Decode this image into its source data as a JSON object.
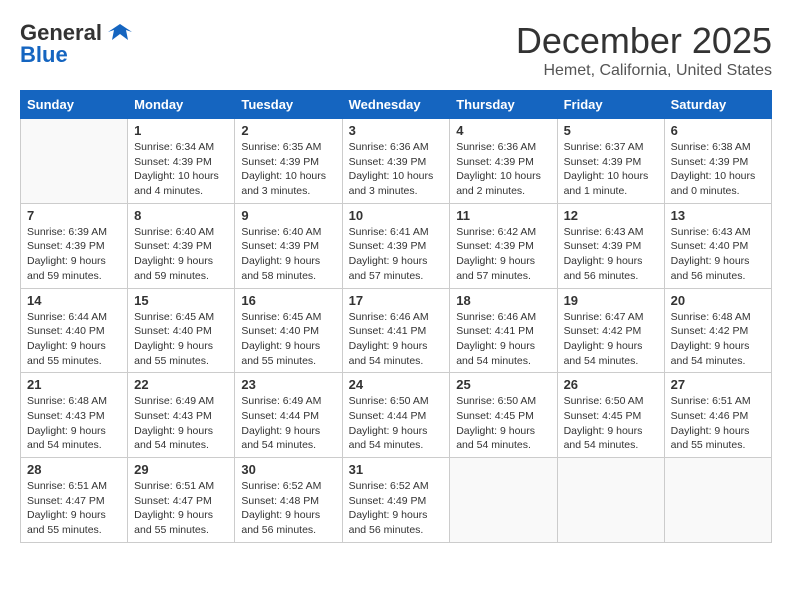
{
  "header": {
    "logo_line1": "General",
    "logo_line2": "Blue",
    "title": "December 2025",
    "subtitle": "Hemet, California, United States"
  },
  "days_of_week": [
    "Sunday",
    "Monday",
    "Tuesday",
    "Wednesday",
    "Thursday",
    "Friday",
    "Saturday"
  ],
  "weeks": [
    [
      {
        "day": "",
        "info": ""
      },
      {
        "day": "1",
        "info": "Sunrise: 6:34 AM\nSunset: 4:39 PM\nDaylight: 10 hours\nand 4 minutes."
      },
      {
        "day": "2",
        "info": "Sunrise: 6:35 AM\nSunset: 4:39 PM\nDaylight: 10 hours\nand 3 minutes."
      },
      {
        "day": "3",
        "info": "Sunrise: 6:36 AM\nSunset: 4:39 PM\nDaylight: 10 hours\nand 3 minutes."
      },
      {
        "day": "4",
        "info": "Sunrise: 6:36 AM\nSunset: 4:39 PM\nDaylight: 10 hours\nand 2 minutes."
      },
      {
        "day": "5",
        "info": "Sunrise: 6:37 AM\nSunset: 4:39 PM\nDaylight: 10 hours\nand 1 minute."
      },
      {
        "day": "6",
        "info": "Sunrise: 6:38 AM\nSunset: 4:39 PM\nDaylight: 10 hours\nand 0 minutes."
      }
    ],
    [
      {
        "day": "7",
        "info": "Sunrise: 6:39 AM\nSunset: 4:39 PM\nDaylight: 9 hours\nand 59 minutes."
      },
      {
        "day": "8",
        "info": "Sunrise: 6:40 AM\nSunset: 4:39 PM\nDaylight: 9 hours\nand 59 minutes."
      },
      {
        "day": "9",
        "info": "Sunrise: 6:40 AM\nSunset: 4:39 PM\nDaylight: 9 hours\nand 58 minutes."
      },
      {
        "day": "10",
        "info": "Sunrise: 6:41 AM\nSunset: 4:39 PM\nDaylight: 9 hours\nand 57 minutes."
      },
      {
        "day": "11",
        "info": "Sunrise: 6:42 AM\nSunset: 4:39 PM\nDaylight: 9 hours\nand 57 minutes."
      },
      {
        "day": "12",
        "info": "Sunrise: 6:43 AM\nSunset: 4:39 PM\nDaylight: 9 hours\nand 56 minutes."
      },
      {
        "day": "13",
        "info": "Sunrise: 6:43 AM\nSunset: 4:40 PM\nDaylight: 9 hours\nand 56 minutes."
      }
    ],
    [
      {
        "day": "14",
        "info": "Sunrise: 6:44 AM\nSunset: 4:40 PM\nDaylight: 9 hours\nand 55 minutes."
      },
      {
        "day": "15",
        "info": "Sunrise: 6:45 AM\nSunset: 4:40 PM\nDaylight: 9 hours\nand 55 minutes."
      },
      {
        "day": "16",
        "info": "Sunrise: 6:45 AM\nSunset: 4:40 PM\nDaylight: 9 hours\nand 55 minutes."
      },
      {
        "day": "17",
        "info": "Sunrise: 6:46 AM\nSunset: 4:41 PM\nDaylight: 9 hours\nand 54 minutes."
      },
      {
        "day": "18",
        "info": "Sunrise: 6:46 AM\nSunset: 4:41 PM\nDaylight: 9 hours\nand 54 minutes."
      },
      {
        "day": "19",
        "info": "Sunrise: 6:47 AM\nSunset: 4:42 PM\nDaylight: 9 hours\nand 54 minutes."
      },
      {
        "day": "20",
        "info": "Sunrise: 6:48 AM\nSunset: 4:42 PM\nDaylight: 9 hours\nand 54 minutes."
      }
    ],
    [
      {
        "day": "21",
        "info": "Sunrise: 6:48 AM\nSunset: 4:43 PM\nDaylight: 9 hours\nand 54 minutes."
      },
      {
        "day": "22",
        "info": "Sunrise: 6:49 AM\nSunset: 4:43 PM\nDaylight: 9 hours\nand 54 minutes."
      },
      {
        "day": "23",
        "info": "Sunrise: 6:49 AM\nSunset: 4:44 PM\nDaylight: 9 hours\nand 54 minutes."
      },
      {
        "day": "24",
        "info": "Sunrise: 6:50 AM\nSunset: 4:44 PM\nDaylight: 9 hours\nand 54 minutes."
      },
      {
        "day": "25",
        "info": "Sunrise: 6:50 AM\nSunset: 4:45 PM\nDaylight: 9 hours\nand 54 minutes."
      },
      {
        "day": "26",
        "info": "Sunrise: 6:50 AM\nSunset: 4:45 PM\nDaylight: 9 hours\nand 54 minutes."
      },
      {
        "day": "27",
        "info": "Sunrise: 6:51 AM\nSunset: 4:46 PM\nDaylight: 9 hours\nand 55 minutes."
      }
    ],
    [
      {
        "day": "28",
        "info": "Sunrise: 6:51 AM\nSunset: 4:47 PM\nDaylight: 9 hours\nand 55 minutes."
      },
      {
        "day": "29",
        "info": "Sunrise: 6:51 AM\nSunset: 4:47 PM\nDaylight: 9 hours\nand 55 minutes."
      },
      {
        "day": "30",
        "info": "Sunrise: 6:52 AM\nSunset: 4:48 PM\nDaylight: 9 hours\nand 56 minutes."
      },
      {
        "day": "31",
        "info": "Sunrise: 6:52 AM\nSunset: 4:49 PM\nDaylight: 9 hours\nand 56 minutes."
      },
      {
        "day": "",
        "info": ""
      },
      {
        "day": "",
        "info": ""
      },
      {
        "day": "",
        "info": ""
      }
    ]
  ]
}
